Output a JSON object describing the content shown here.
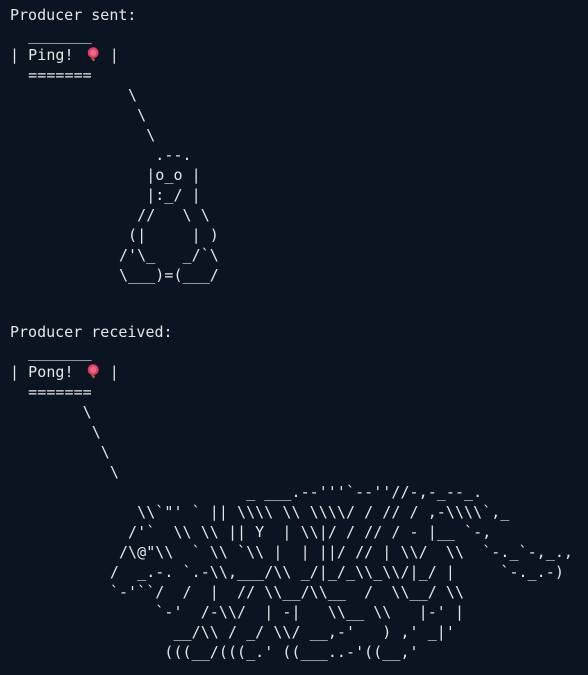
{
  "terminal": {
    "sent": {
      "heading": "Producer sent:",
      "bubble_top": "  _______",
      "bubble_text_prefix": "| Ping! ",
      "bubble_text_suffix": " |",
      "bubble_bottom": "  =======",
      "art": "             \\\n              \\\n               \\\n                .--.\n               |o_o |\n               |:_/ |\n              //   \\ \\\n             (|     | )\n            /'\\_   _/`\\\n            \\___)=(___/"
    },
    "received": {
      "heading": "Producer received:",
      "bubble_top": "  _______",
      "bubble_text_prefix": "| Pong! ",
      "bubble_text_suffix": " |",
      "bubble_bottom": "  =======",
      "art": "        \\\n         \\\n          \\\n           \\\n                          _ ___.--'''`--''//-,-_--_.\n              \\\\`\"' ` || \\\\\\\\ \\\\ \\\\\\\\/ / // / ,-\\\\\\\\`,_\n             /'`  \\\\ \\\\ || Y  | \\\\|/ / // / - |__ `-,\n            /\\@\"\\\\  ` \\\\ `\\\\ |  | ||/ // | \\\\/  \\\\  `-._`-,_.,\n           /  _.-. `.-\\\\,___/\\\\ _/|_/_\\\\_\\\\/|_/ |     `-._.-)\n           `-'``/  /  |  // \\\\__/\\\\__  /  \\\\__/ \\\\\n                `-'  /-\\\\/  | -|   \\\\__ \\\\   |-' |\n                  __/\\\\ / _/ \\\\/ __,-'   ) ,' _|'\n                 (((__/(((_.' ((___..-'((__,'"
    },
    "icons": {
      "ping": "ping-pong-paddle-icon",
      "pong": "ping-pong-paddle-icon"
    },
    "colors": {
      "background": "#0b1521",
      "foreground": "#e6e6e6",
      "paddle": "#e13d63"
    }
  }
}
